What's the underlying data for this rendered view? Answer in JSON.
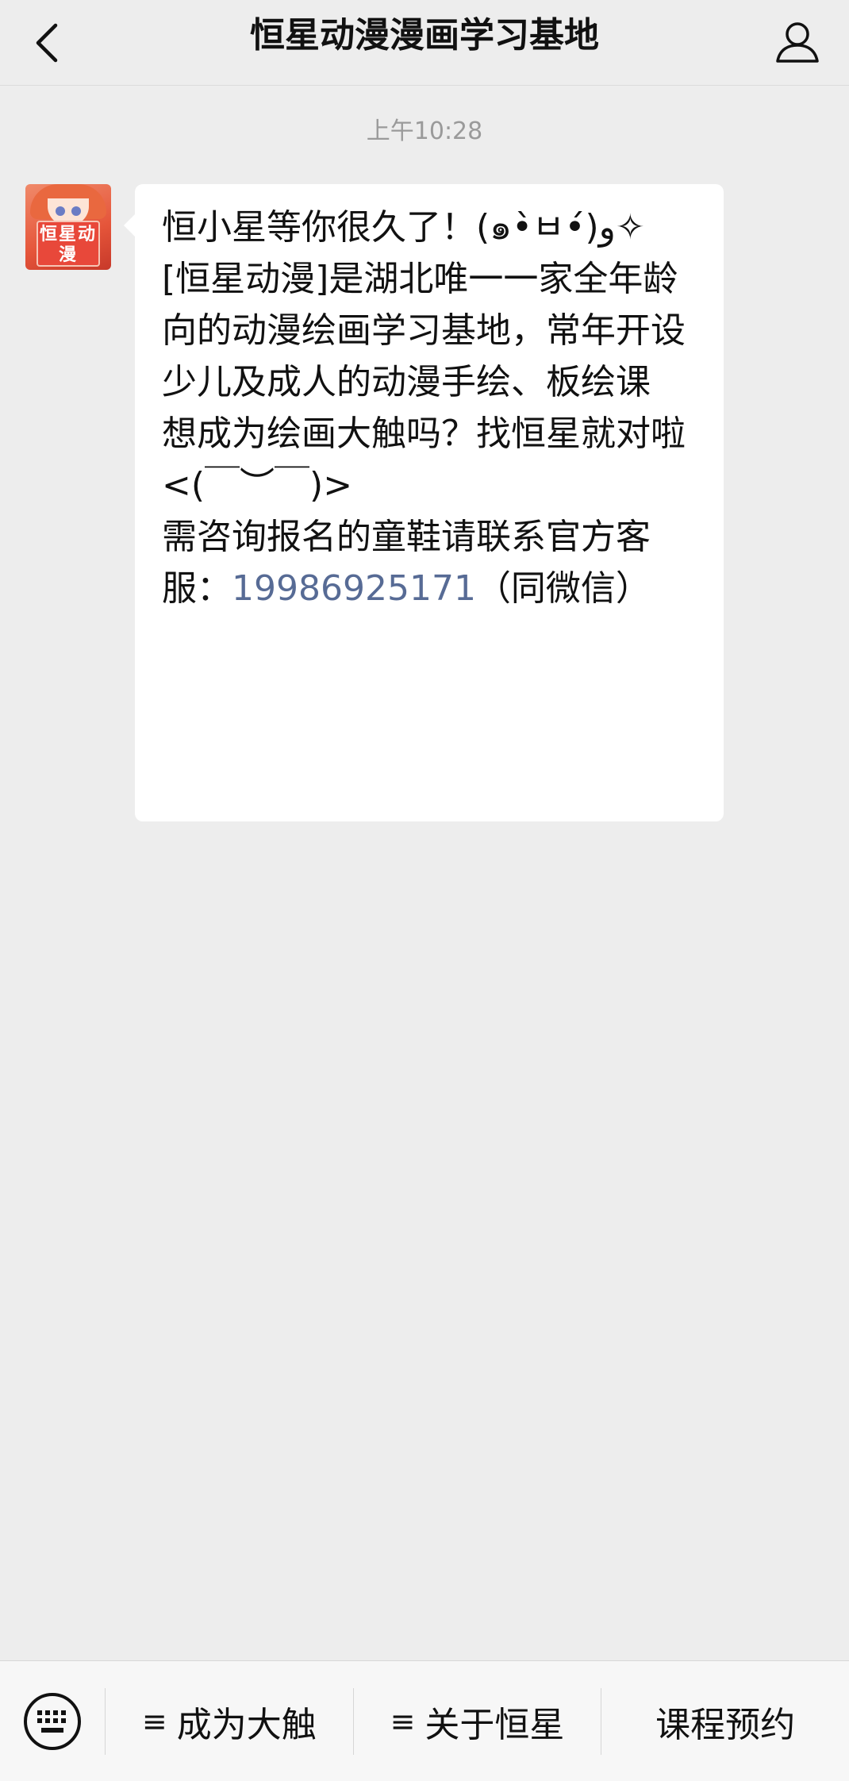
{
  "header": {
    "title": "恒星动漫漫画学习基地",
    "back_icon": "chevron-left-icon",
    "profile_icon": "user-icon"
  },
  "chat": {
    "timestamp": "上午10:28",
    "avatar_text": "恒星动漫",
    "message": {
      "text_before_phone": "恒小星等你很久了！(๑•̀ㅂ•́)و✧\n[恒星动漫]是湖北唯一一家全年龄向的动漫绘画学习基地，常年开设少儿及成人的动漫手绘、板绘课\n想成为绘画大触吗？找恒星就对啦<(￣︶￣)>\n需咨询报名的童鞋请联系官方客服：",
      "phone": "19986925171",
      "text_after_phone": "（同微信）"
    }
  },
  "menubar": {
    "keyboard_icon": "keyboard-icon",
    "menu_icon": "≡",
    "items": [
      {
        "label": "成为大触",
        "has_submenu": true
      },
      {
        "label": "关于恒星",
        "has_submenu": true
      },
      {
        "label": "课程预约",
        "has_submenu": false
      }
    ]
  },
  "colors": {
    "background": "#ededed",
    "bubble": "#ffffff",
    "link": "#576b95",
    "timestamp": "#9a9a9a"
  }
}
